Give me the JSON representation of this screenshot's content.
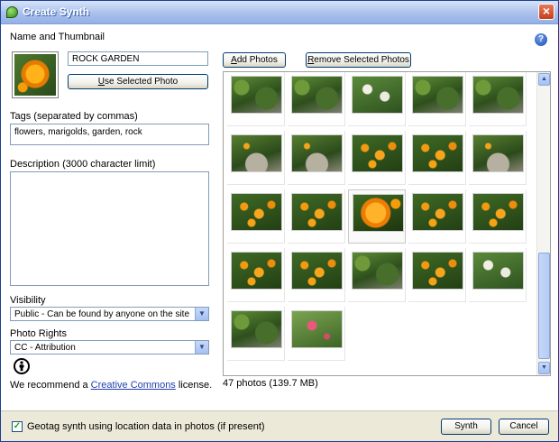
{
  "window": {
    "title": "Create Synth",
    "close_glyph": "×",
    "help_glyph": "?"
  },
  "name_thumbnail": {
    "label": "Name and Thumbnail",
    "name_value": "ROCK GARDEN",
    "use_selected_button": {
      "underlined": "U",
      "rest": "se Selected Photo"
    }
  },
  "tags": {
    "label": "Tags (separated by commas)",
    "value": "flowers, marigolds, garden, rock"
  },
  "description": {
    "label": "Description (3000 character limit)",
    "value": ""
  },
  "visibility": {
    "label": "Visibility",
    "value": "Public - Can be found by anyone on the site",
    "arrow": "▼"
  },
  "photo_rights": {
    "label": "Photo Rights",
    "value": "CC - Attribution",
    "arrow": "▼",
    "cc_icon_glyph": "ⓘ"
  },
  "recommend": {
    "prefix": "We recommend a ",
    "link_text": "Creative Commons",
    "suffix": " license."
  },
  "toolbar": {
    "add_photos": {
      "underlined": "A",
      "rest": "dd Photos"
    },
    "remove_selected": {
      "underlined": "R",
      "rest": "emove Selected Photos"
    }
  },
  "photos": {
    "count_text": "47 photos (139.7 MB)",
    "items": [
      {
        "style": "p-green"
      },
      {
        "style": "p-green"
      },
      {
        "style": "p-white"
      },
      {
        "style": "p-green"
      },
      {
        "style": "p-green"
      },
      {
        "style": "p-rock"
      },
      {
        "style": "p-rock"
      },
      {
        "style": "p-orange"
      },
      {
        "style": "p-orange"
      },
      {
        "style": "p-rock"
      },
      {
        "style": "p-orange"
      },
      {
        "style": "p-orange"
      },
      {
        "style": "p-big",
        "selected": true
      },
      {
        "style": "p-orange"
      },
      {
        "style": "p-orange"
      },
      {
        "style": "p-orange"
      },
      {
        "style": "p-orange"
      },
      {
        "style": "p-green"
      },
      {
        "style": "p-orange"
      },
      {
        "style": "p-white"
      },
      {
        "style": "p-green"
      },
      {
        "style": "p-pink"
      }
    ]
  },
  "scrollbar": {
    "up_glyph": "▲",
    "down_glyph": "▼"
  },
  "footer": {
    "geotag_checked": true,
    "check_glyph": "✓",
    "geotag_label": "Geotag synth using location data in photos (if present)",
    "synth_label": "Synth",
    "cancel_label": "Cancel"
  }
}
